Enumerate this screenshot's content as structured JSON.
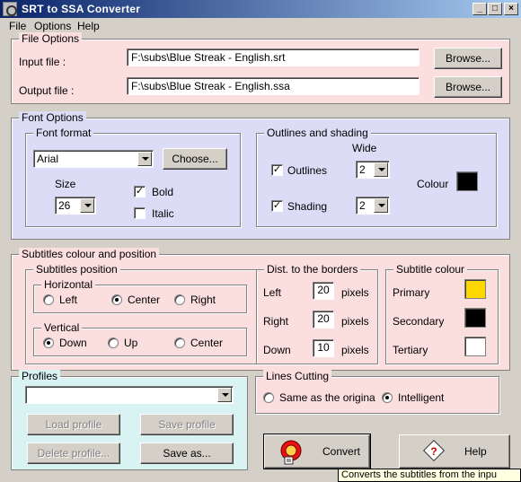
{
  "window": {
    "title": "SRT to SSA Converter"
  },
  "menu": [
    "File",
    "Options",
    "Help"
  ],
  "file_options": {
    "legend": "File Options",
    "input_label": "Input file :",
    "input_value": "F:\\subs\\Blue Streak - English.srt",
    "output_label": "Output file :",
    "output_value": "F:\\subs\\Blue Streak - English.ssa",
    "browse_label": "Browse..."
  },
  "font_options": {
    "legend": "Font Options",
    "font_format_legend": "Font format",
    "font_value": "Arial",
    "choose_label": "Choose...",
    "size_label": "Size",
    "size_value": "26",
    "bold_label": "Bold",
    "bold_checked": true,
    "italic_label": "Italic",
    "italic_checked": false,
    "outlines_legend": "Outlines and shading",
    "wide_label": "Wide",
    "outlines_label": "Outlines",
    "outlines_checked": true,
    "outlines_wide": "2",
    "shading_label": "Shading",
    "shading_checked": true,
    "shading_wide": "2",
    "colour_label": "Colour",
    "colour_value": "#000000"
  },
  "subtitles": {
    "legend": "Subtitles colour and position",
    "position_legend": "Subtitles position",
    "horizontal_legend": "Horizontal",
    "h_left": "Left",
    "h_center": "Center",
    "h_right": "Right",
    "h_selected": "Center",
    "vertical_legend": "Vertical",
    "v_down": "Down",
    "v_up": "Up",
    "v_center": "Center",
    "v_selected": "Down",
    "dist_legend": "Dist. to the borders",
    "left_label": "Left",
    "left_value": "20",
    "right_label": "Right",
    "right_value": "20",
    "down_label": "Down",
    "down_value": "10",
    "pixels_label": "pixels",
    "colour_legend": "Subtitle colour",
    "primary_label": "Primary",
    "primary_color": "#ffd700",
    "secondary_label": "Secondary",
    "secondary_color": "#000000",
    "tertiary_label": "Tertiary",
    "tertiary_color": "#ffffff"
  },
  "profiles": {
    "legend": "Profiles",
    "selected": "",
    "load_label": "Load profile",
    "save_label": "Save profile",
    "delete_label": "Delete profile...",
    "save_as_label": "Save as..."
  },
  "lines_cutting": {
    "legend": "Lines Cutting",
    "same_label": "Same as the origina",
    "intelligent_label": "Intelligent",
    "selected": "Intelligent"
  },
  "actions": {
    "convert_label": "Convert",
    "help_label": "Help"
  },
  "tooltip": "Converts the subtitles from the inpu"
}
